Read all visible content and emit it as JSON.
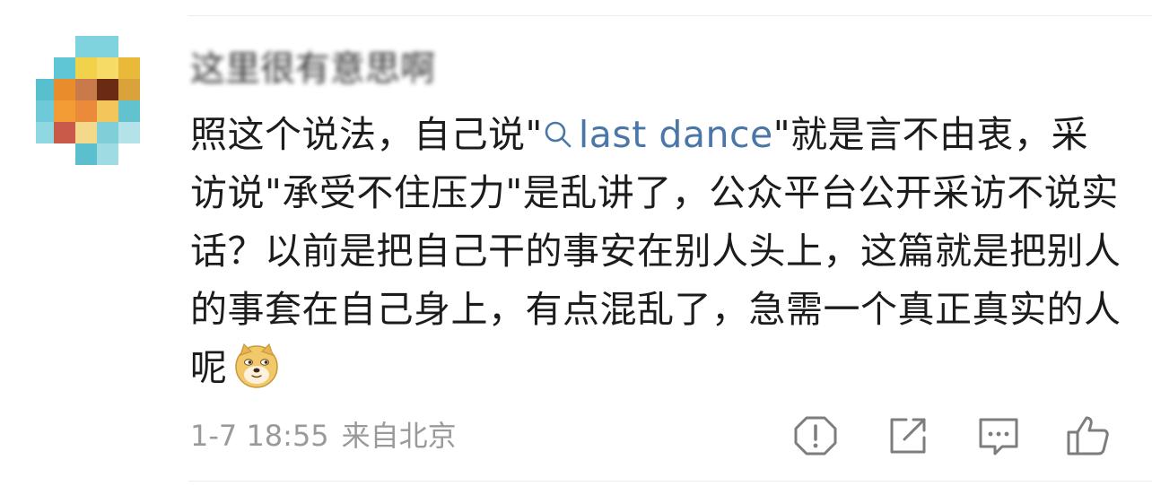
{
  "comment": {
    "username": "这里很有意思啊",
    "text_before_link": "照这个说法，自己说\"",
    "link_text": "last dance",
    "text_after_link": "\"就是言不由衷，采访说\"承受不住压力\"是乱讲了，公众平台公开采访不说实话？以前是把自己干的事安在别人头上，这篇就是把别人的事套在自己身上，有点混乱了，急需一个真正真实的人呢",
    "date": "1-7 18:55",
    "location": "来自北京"
  },
  "icons": {
    "avatar": "pixelated-avatar",
    "link_icon": "magnifier-icon",
    "emoji": "doge-emoji",
    "report": "report-icon",
    "share": "share-icon",
    "reply": "comment-icon",
    "like": "thumbs-up-icon"
  },
  "colors": {
    "link": "#4a76a8",
    "text": "#1c1c1c",
    "meta": "#9a9a9a",
    "icon": "#7d7d7d"
  }
}
